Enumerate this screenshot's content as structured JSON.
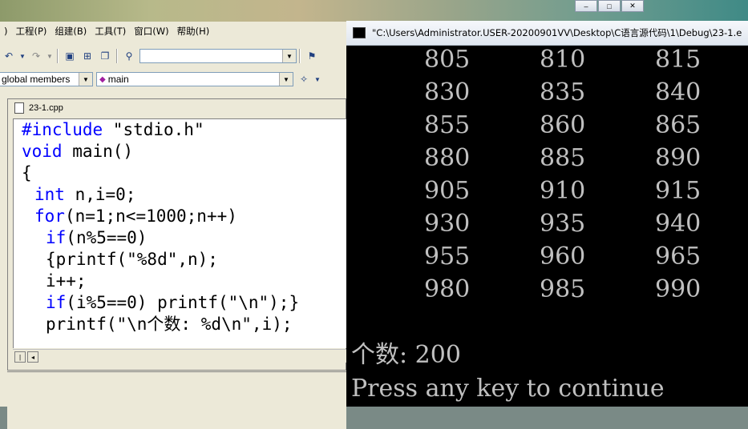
{
  "window_buttons": [
    "–",
    "□",
    "✕"
  ],
  "ide": {
    "menu": [
      {
        "label": ")"
      },
      {
        "label": "工程(P)"
      },
      {
        "label": "组建(B)"
      },
      {
        "label": "工具(T)"
      },
      {
        "label": "窗口(W)"
      },
      {
        "label": "帮助(H)"
      }
    ],
    "toolbar": {
      "find_combo_value": "",
      "class_combo_value": "global members",
      "member_combo_value": "main"
    },
    "editor": {
      "file_name": "23-1.cpp",
      "code_lines": [
        {
          "kw": "#include",
          "rest": " \"stdio.h\"",
          "indent": 0
        },
        {
          "kw": "void",
          "rest": " main()",
          "indent": 0
        },
        {
          "kw": "",
          "rest": "{",
          "indent": 0
        },
        {
          "kw": "int",
          "rest": " n,i=0;",
          "indent": 1
        },
        {
          "kw": "for",
          "rest": "(n=1;n<=1000;n++)",
          "indent": 1
        },
        {
          "kw": "if",
          "rest": "(n%5==0)",
          "indent": 2
        },
        {
          "kw": "",
          "rest": "{printf(\"%8d\",n);",
          "indent": 2
        },
        {
          "kw": "",
          "rest": "i++;",
          "indent": 2
        },
        {
          "kw": "if",
          "rest": "(i%5==0) printf(\"\\n\");}",
          "indent": 2
        },
        {
          "kw": "",
          "rest": "printf(\"\\n个数: %d\\n\",i);",
          "indent": 2
        }
      ]
    }
  },
  "console": {
    "title": "\"C:\\Users\\Administrator.USER-20200901VV\\Desktop\\C语言源代码\\1\\Debug\\23-1.e",
    "rows": [
      [
        "805",
        "810",
        "815"
      ],
      [
        "830",
        "835",
        "840"
      ],
      [
        "855",
        "860",
        "865"
      ],
      [
        "880",
        "885",
        "890"
      ],
      [
        "905",
        "910",
        "915"
      ],
      [
        "930",
        "935",
        "940"
      ],
      [
        "955",
        "960",
        "965"
      ],
      [
        "980",
        "985",
        "990"
      ]
    ],
    "count_line": "个数: 200",
    "press_line": "Press any key to continue"
  }
}
